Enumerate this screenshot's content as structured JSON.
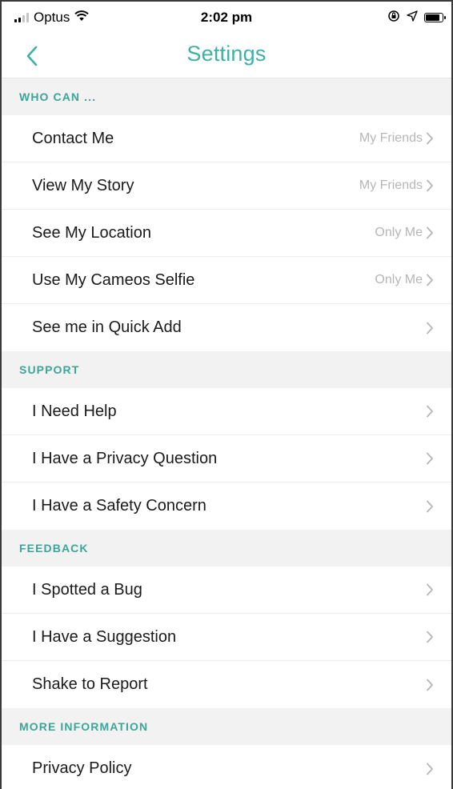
{
  "status_bar": {
    "carrier": "Optus",
    "time": "2:02 pm"
  },
  "nav": {
    "title": "Settings"
  },
  "colors": {
    "accent": "#3cb2a2",
    "section_bg": "#f2f2f2",
    "value_text": "#b6b6b6"
  },
  "sections": {
    "who_can": {
      "header": "WHO CAN ...",
      "items": [
        {
          "label": "Contact Me",
          "value": "My Friends"
        },
        {
          "label": "View My Story",
          "value": "My Friends"
        },
        {
          "label": "See My Location",
          "value": "Only Me"
        },
        {
          "label": "Use My Cameos Selfie",
          "value": "Only Me"
        },
        {
          "label": "See me in Quick Add",
          "value": ""
        }
      ]
    },
    "support": {
      "header": "SUPPORT",
      "items": [
        {
          "label": "I Need Help"
        },
        {
          "label": "I Have a Privacy Question"
        },
        {
          "label": "I Have a Safety Concern"
        }
      ]
    },
    "feedback": {
      "header": "FEEDBACK",
      "items": [
        {
          "label": "I Spotted a Bug"
        },
        {
          "label": "I Have a Suggestion"
        },
        {
          "label": "Shake to Report"
        }
      ]
    },
    "more_information": {
      "header": "MORE INFORMATION",
      "items": [
        {
          "label": "Privacy Policy"
        }
      ]
    }
  }
}
